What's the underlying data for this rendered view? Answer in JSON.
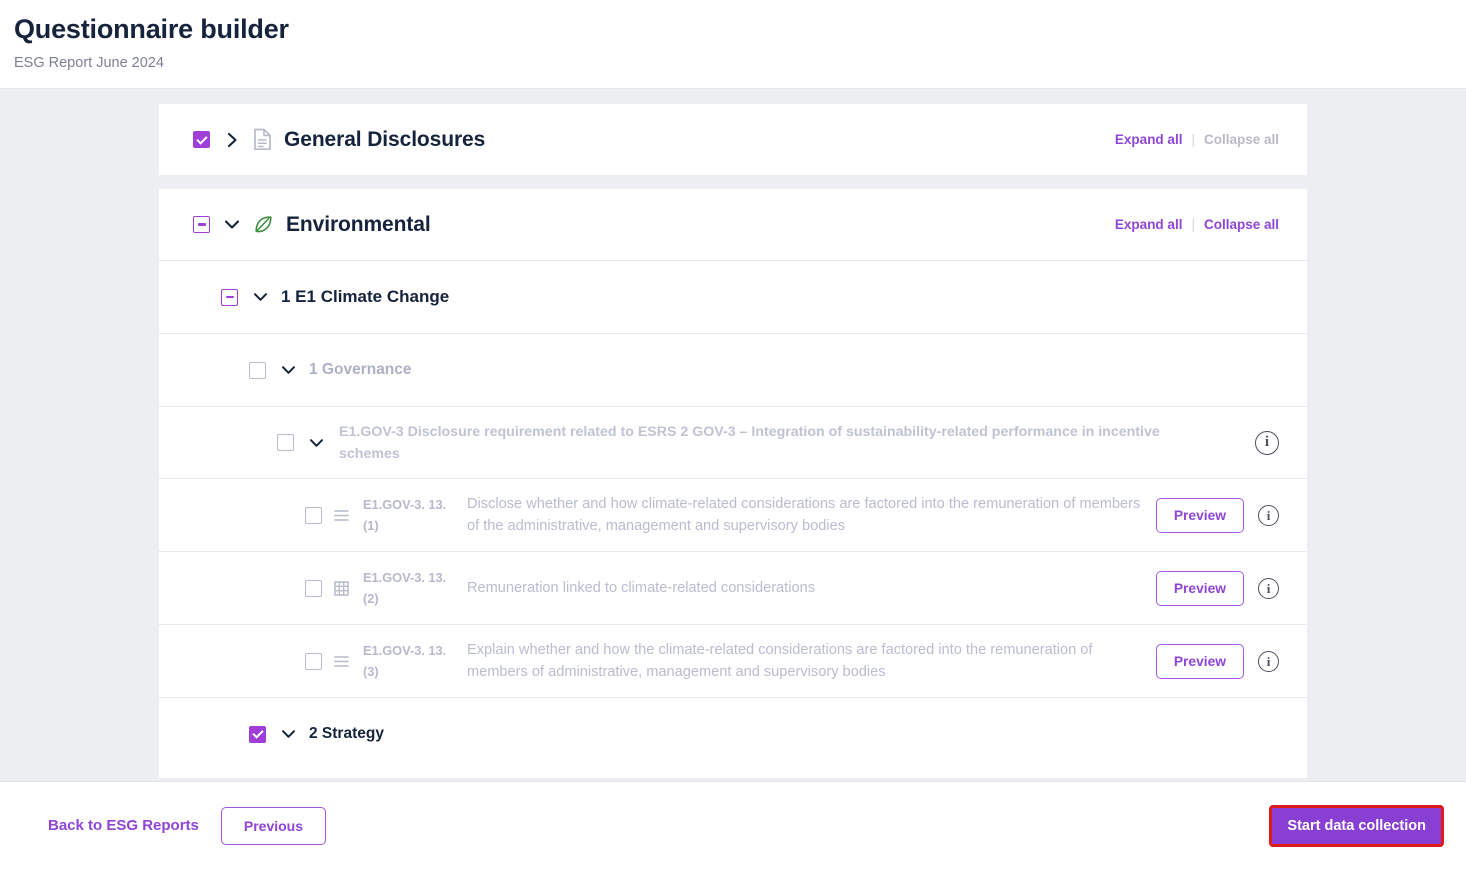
{
  "header": {
    "title": "Questionnaire builder",
    "subtitle": "ESG Report June 2024"
  },
  "colors": {
    "accent_purple": "#8f45d6",
    "checkbox_purple": "#a03fd8",
    "leaf_green": "#3f8f3f",
    "title_navy": "#16233c",
    "muted_text": "#b9bdcf",
    "highlight_red": "#e01b1b"
  },
  "links": {
    "expand_all": "Expand all",
    "collapse_all": "Collapse all",
    "separator": "|"
  },
  "sections": [
    {
      "id": "general-disclosures",
      "title": "General Disclosures",
      "checkbox_state": "checked",
      "chevron": "right",
      "icon": "document-icon",
      "expand_all_enabled": true,
      "collapse_all_enabled": false
    },
    {
      "id": "environmental",
      "title": "Environmental",
      "checkbox_state": "indeterminate",
      "chevron": "down",
      "icon": "leaf-icon",
      "expand_all_enabled": true,
      "collapse_all_enabled": true
    }
  ],
  "topic": {
    "title": "1 E1 Climate Change",
    "checkbox_state": "indeterminate",
    "chevron": "down"
  },
  "subtopics": [
    {
      "title": "1 Governance",
      "checkbox_state": "unchecked",
      "chevron": "down",
      "muted": true
    },
    {
      "title": "2 Strategy",
      "checkbox_state": "checked",
      "chevron": "down",
      "muted": false
    }
  ],
  "disclosure_requirement": {
    "label": "E1.GOV-3 Disclosure requirement related to ESRS 2 GOV-3 – Integration of sustainability-related performance in incentive schemes",
    "checkbox_state": "unchecked",
    "chevron": "down",
    "info_icon": "info-icon"
  },
  "questions": [
    {
      "code": "E1.GOV-3. 13. (1)",
      "text": "Disclose whether and how climate-related considerations are factored into the remuneration of members of the administrative, management and supervisory bodies",
      "icon": "list-lines-icon",
      "checkbox_state": "unchecked",
      "preview_label": "Preview",
      "info_icon": "info-icon"
    },
    {
      "code": "E1.GOV-3. 13. (2)",
      "text": "Remuneration linked to climate-related considerations",
      "icon": "table-grid-icon",
      "checkbox_state": "unchecked",
      "preview_label": "Preview",
      "info_icon": "info-icon"
    },
    {
      "code": "E1.GOV-3. 13. (3)",
      "text": "Explain whether and how the climate-related considerations are factored into the remuneration of members of administrative, management and supervisory bodies",
      "icon": "list-lines-icon",
      "checkbox_state": "unchecked",
      "preview_label": "Preview",
      "info_icon": "info-icon"
    }
  ],
  "footer": {
    "back_label": "Back to ESG Reports",
    "previous_label": "Previous",
    "start_label": "Start data collection"
  },
  "info_glyph": "i"
}
